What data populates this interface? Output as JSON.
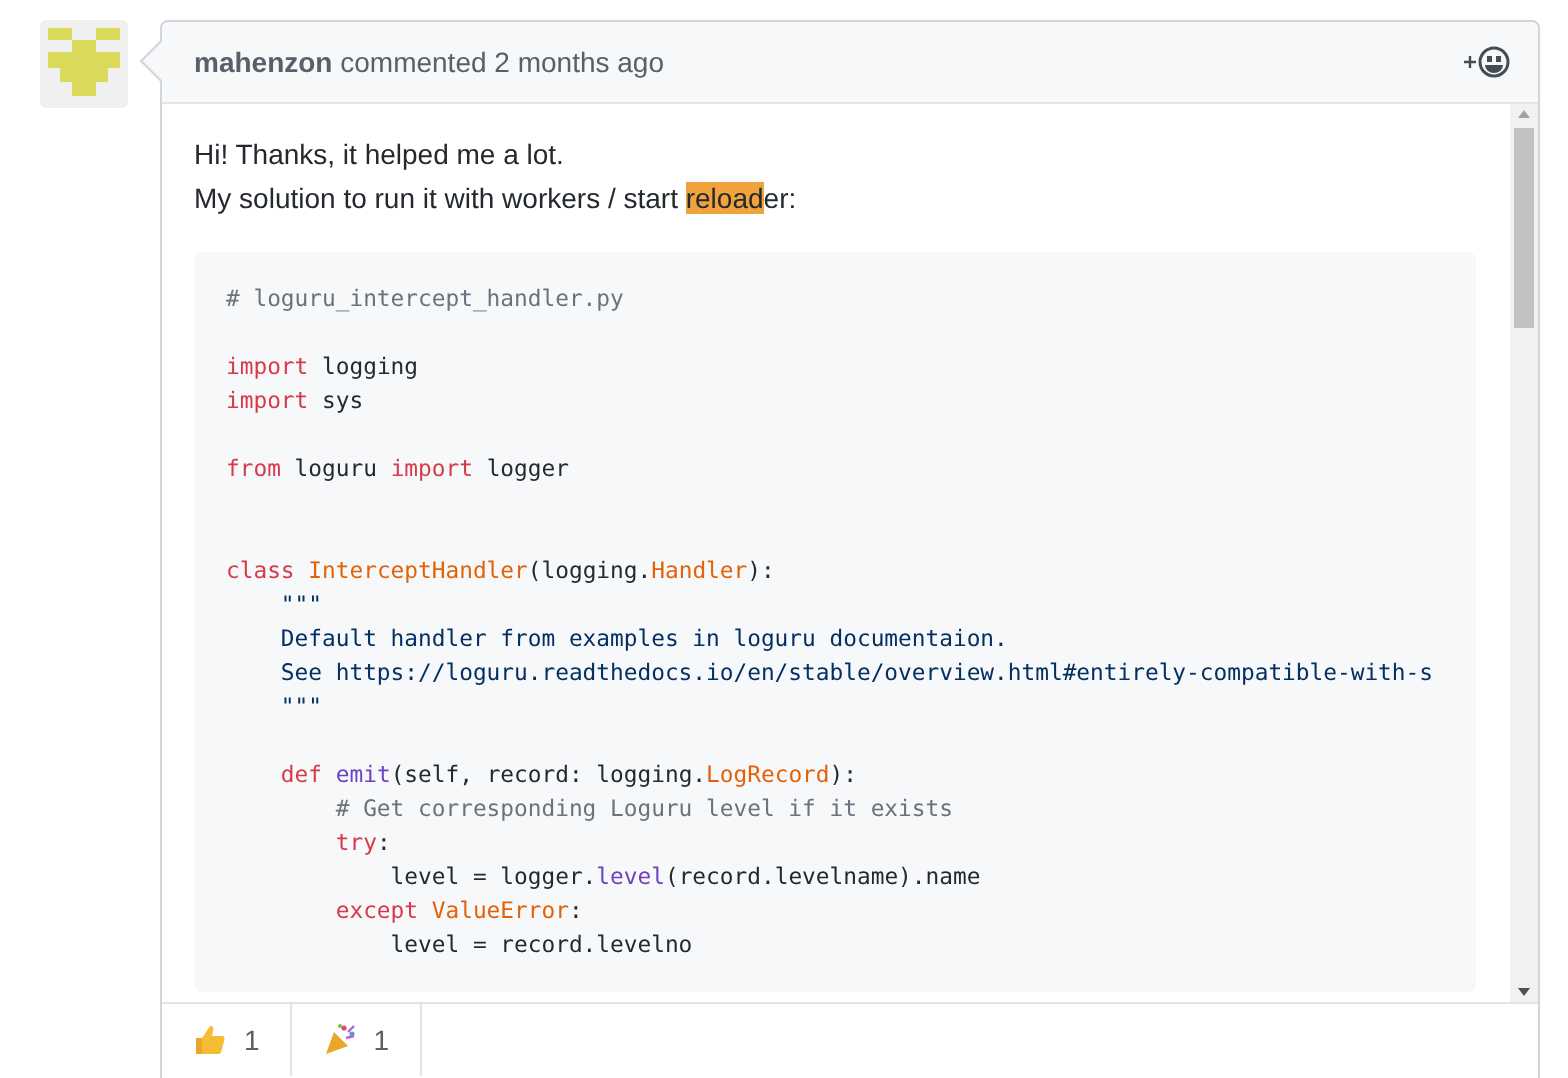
{
  "comment": {
    "author": "mahenzon",
    "action": "commented 2 months ago",
    "paragraph_lines": [
      {
        "parts": [
          {
            "text": "Hi! Thanks, it helped me a lot.",
            "highlight": false
          }
        ]
      },
      {
        "parts": [
          {
            "text": "My solution to run it with workers / start ",
            "highlight": false
          },
          {
            "text": "reload",
            "highlight": true
          },
          {
            "text": "er:",
            "highlight": false
          }
        ]
      }
    ],
    "code_lines": [
      {
        "kind": "code",
        "tokens": [
          {
            "kind": "comment",
            "text": "# loguru_intercept_handler.py"
          }
        ]
      },
      {
        "kind": "blank"
      },
      {
        "kind": "code",
        "tokens": [
          {
            "kind": "keyword",
            "text": "import"
          },
          {
            "kind": "plain",
            "text": " logging"
          }
        ]
      },
      {
        "kind": "code",
        "tokens": [
          {
            "kind": "keyword",
            "text": "import"
          },
          {
            "kind": "plain",
            "text": " sys"
          }
        ]
      },
      {
        "kind": "blank"
      },
      {
        "kind": "code",
        "tokens": [
          {
            "kind": "keyword",
            "text": "from"
          },
          {
            "kind": "plain",
            "text": " loguru "
          },
          {
            "kind": "keyword",
            "text": "import"
          },
          {
            "kind": "plain",
            "text": " logger"
          }
        ]
      },
      {
        "kind": "blank"
      },
      {
        "kind": "blank"
      },
      {
        "kind": "code",
        "tokens": [
          {
            "kind": "keyword",
            "text": "class "
          },
          {
            "kind": "class",
            "text": "InterceptHandler"
          },
          {
            "kind": "plain",
            "text": "(logging."
          },
          {
            "kind": "class",
            "text": "Handler"
          },
          {
            "kind": "plain",
            "text": "):"
          }
        ]
      },
      {
        "kind": "code",
        "tokens": [
          {
            "kind": "string",
            "text": "    \"\"\""
          }
        ]
      },
      {
        "kind": "code",
        "tokens": [
          {
            "kind": "string",
            "text": "    Default handler from examples in loguru documentaion."
          }
        ]
      },
      {
        "kind": "code",
        "tokens": [
          {
            "kind": "string",
            "text": "    See https://loguru.readthedocs.io/en/stable/overview.html#entirely-compatible-with-s"
          }
        ]
      },
      {
        "kind": "code",
        "tokens": [
          {
            "kind": "string",
            "text": "    \"\"\""
          }
        ]
      },
      {
        "kind": "blank"
      },
      {
        "kind": "code",
        "tokens": [
          {
            "kind": "keyword",
            "text": "    def "
          },
          {
            "kind": "function",
            "text": "emit"
          },
          {
            "kind": "plain",
            "text": "(self, record: logging."
          },
          {
            "kind": "class",
            "text": "LogRecord"
          },
          {
            "kind": "plain",
            "text": "):"
          }
        ]
      },
      {
        "kind": "code",
        "tokens": [
          {
            "kind": "comment",
            "text": "        # Get corresponding Loguru level if it exists"
          }
        ]
      },
      {
        "kind": "code",
        "tokens": [
          {
            "kind": "keyword",
            "text": "        try"
          },
          {
            "kind": "plain",
            "text": ":"
          }
        ]
      },
      {
        "kind": "code",
        "tokens": [
          {
            "kind": "plain",
            "text": "            level = logger."
          },
          {
            "kind": "function",
            "text": "level"
          },
          {
            "kind": "plain",
            "text": "(record.levelname).name"
          }
        ]
      },
      {
        "kind": "code",
        "tokens": [
          {
            "kind": "keyword",
            "text": "        except "
          },
          {
            "kind": "class",
            "text": "ValueError"
          },
          {
            "kind": "plain",
            "text": ":"
          }
        ]
      },
      {
        "kind": "code",
        "tokens": [
          {
            "kind": "plain",
            "text": "            level = record.levelno"
          }
        ]
      }
    ],
    "reactions": [
      {
        "kind": "thumbs_up",
        "count": "1"
      },
      {
        "kind": "party",
        "count": "1"
      }
    ]
  }
}
